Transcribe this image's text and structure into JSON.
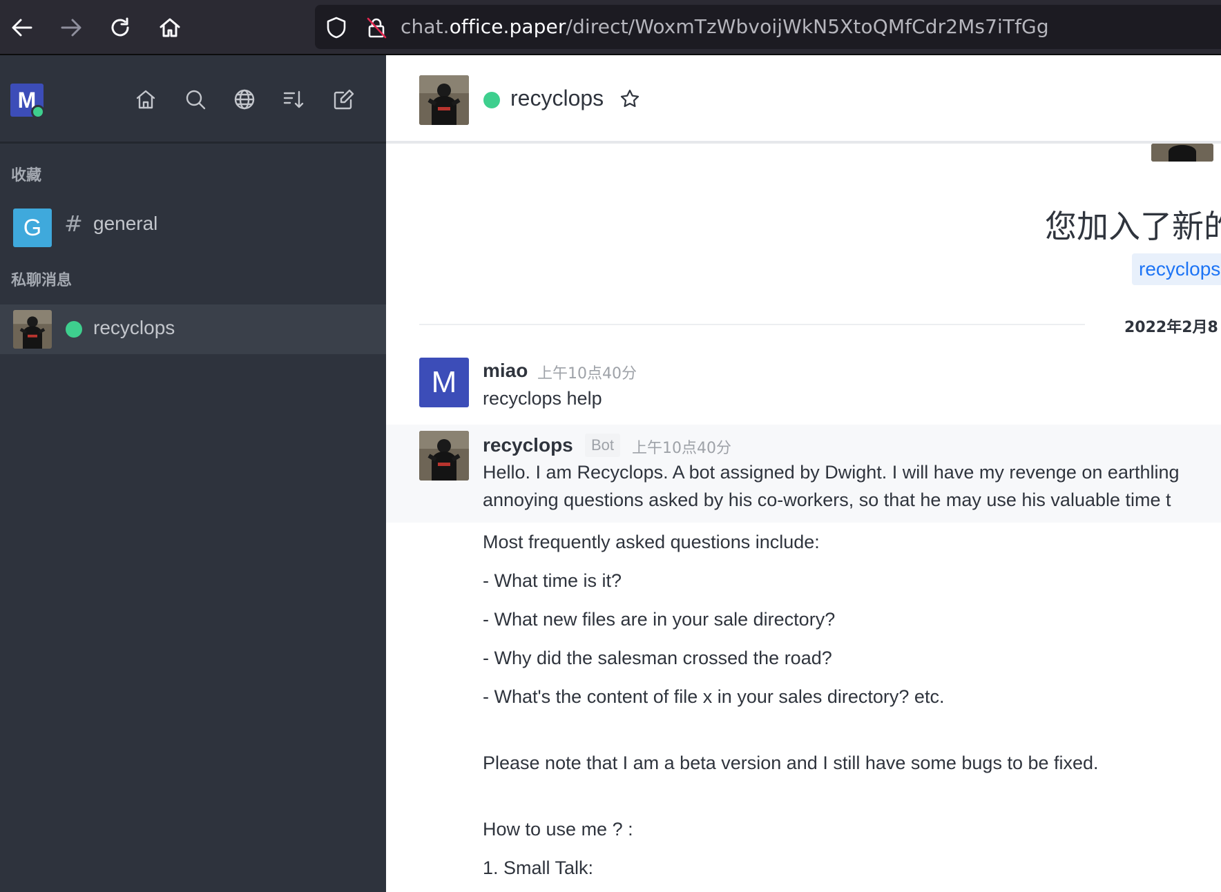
{
  "browser": {
    "url_prefix": "chat.",
    "url_host": "office.paper",
    "url_path": "/direct/WoxmTzWbvoijWkN5XtoQMfCdr2Ms7iTfGg"
  },
  "sidebar": {
    "user_initial": "M",
    "favorites_title": "收藏",
    "favorites": [
      {
        "initial": "G",
        "name": "general"
      }
    ],
    "direct_title": "私聊消息",
    "direct": [
      {
        "name": "recyclops"
      }
    ]
  },
  "room": {
    "title": "recyclops"
  },
  "system": {
    "joined_text": "您加入了新的",
    "mention": "recyclops"
  },
  "divider": {
    "date": "2022年2月8"
  },
  "messages": [
    {
      "author": "miao",
      "initial": "M",
      "time": "上午10点40分",
      "lines": [
        "recyclops help"
      ]
    },
    {
      "author": "recyclops",
      "badge": "Bot",
      "time": "上午10点40分",
      "lines": [
        "Hello. I am Recyclops. A bot assigned by Dwight. I will have my revenge on earthling",
        "annoying questions asked by his co-workers, so that he may use his valuable time t"
      ]
    }
  ],
  "bot_body": [
    "Most frequently asked questions include:",
    "- What time is it?",
    "- What new files are in your sale directory?",
    "- Why did the salesman crossed the road?",
    "- What's the content of file x in your sales directory? etc.",
    "Please note that I am a beta version and I still have some bugs to be fixed.",
    "How to use me ? :",
    "1. Small Talk:"
  ]
}
